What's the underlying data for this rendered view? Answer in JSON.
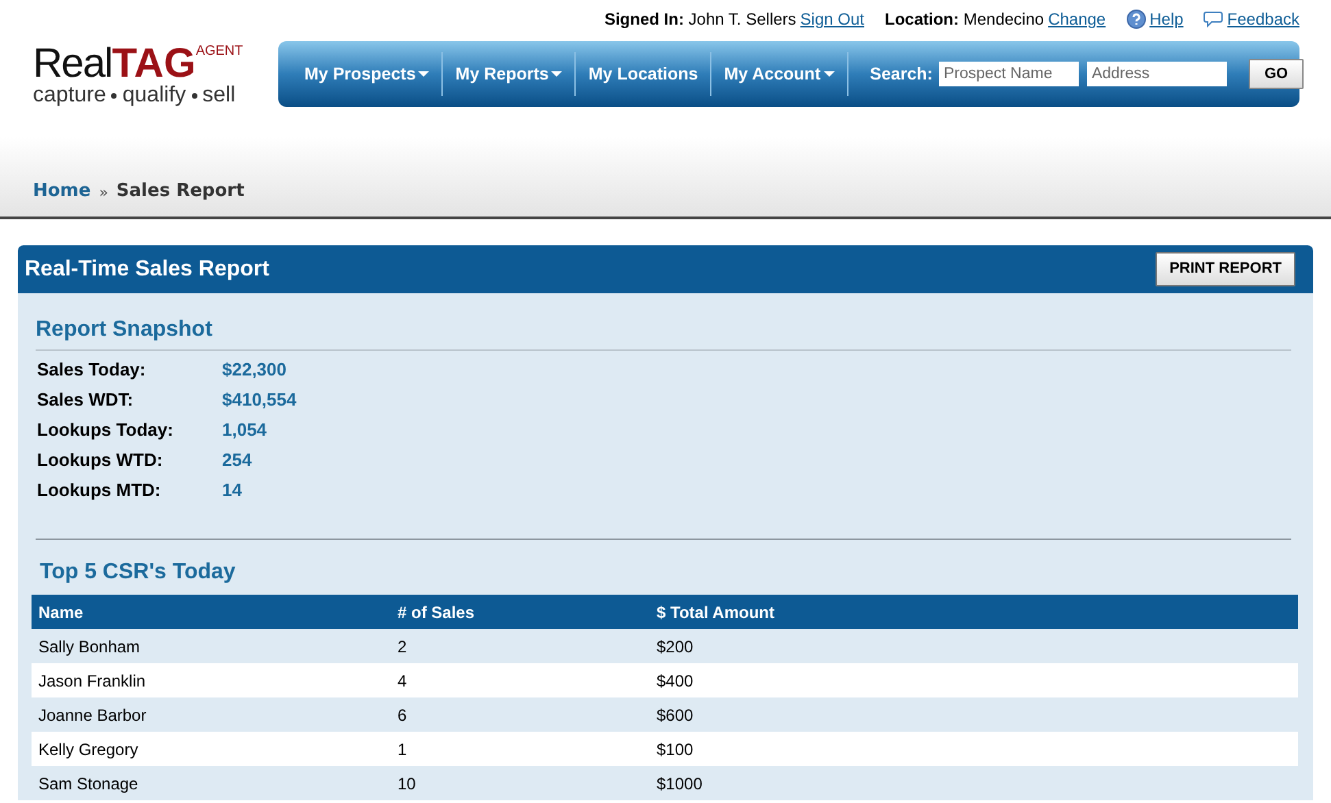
{
  "logo": {
    "brand_plain": "Real",
    "brand_bold": "TAG",
    "brand_sup": "AGENT",
    "tagline": [
      "capture",
      "qualify",
      "sell"
    ]
  },
  "user_bar": {
    "signed_in_label": "Signed In:",
    "user": "John T. Sellers",
    "sign_out": "Sign Out",
    "location_label": "Location:",
    "location": "Mendecino",
    "change": "Change",
    "help": "Help",
    "feedback": "Feedback"
  },
  "nav": [
    {
      "label": "My Prospects",
      "has_menu": true
    },
    {
      "label": "My Reports",
      "has_menu": true
    },
    {
      "label": "My Locations",
      "has_menu": false
    },
    {
      "label": "My Account",
      "has_menu": true
    }
  ],
  "search": {
    "label": "Search:",
    "fields": [
      {
        "placeholder": "Prospect Name"
      },
      {
        "placeholder": "Address"
      }
    ],
    "button": "GO"
  },
  "breadcrumb": [
    {
      "label": "Home",
      "link": true
    },
    {
      "label": "Sales Report",
      "link": false
    }
  ],
  "breadcrumb_separator": "»",
  "panel": {
    "title": "Real-Time Sales Report",
    "print_button": "PRINT REPORT",
    "snapshot_title": "Report Snapshot",
    "snapshot": [
      {
        "label": "Sales Today:",
        "value": "$22,300"
      },
      {
        "label": "Sales WDT:",
        "value": "$410,554"
      },
      {
        "label": "Lookups Today:",
        "value": "1,054"
      },
      {
        "label": "Lookups WTD:",
        "value": "254"
      },
      {
        "label": "Lookups MTD:",
        "value": "14"
      }
    ],
    "top_title": "Top 5 CSR's Today",
    "table": {
      "columns": [
        "Name",
        "# of Sales",
        "$ Total Amount"
      ],
      "rows": [
        [
          "Sally Bonham",
          "2",
          "$200"
        ],
        [
          "Jason Franklin",
          "4",
          "$400"
        ],
        [
          "Joanne Barbor",
          "6",
          "$600"
        ],
        [
          "Kelly Gregory",
          "1",
          "$100"
        ],
        [
          "Sam Stonage",
          "10",
          "$1000"
        ]
      ]
    }
  }
}
